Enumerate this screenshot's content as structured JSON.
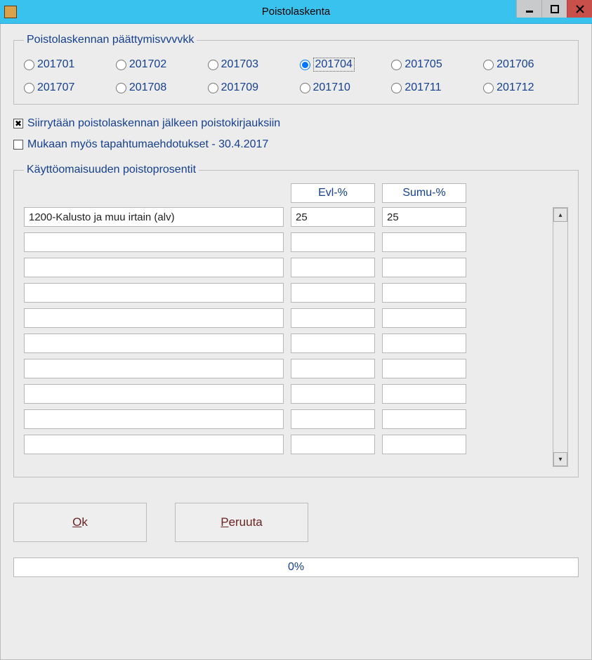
{
  "window": {
    "title": "Poistolaskenta"
  },
  "group_period": {
    "legend": "Poistolaskennan päättymisvvvvkk",
    "options": {
      "o1": "201701",
      "o2": "201702",
      "o3": "201703",
      "o4": "201704",
      "o5": "201705",
      "o6": "201706",
      "o7": "201707",
      "o8": "201708",
      "o9": "201709",
      "o10": "201710",
      "o11": "201711",
      "o12": "201712"
    },
    "selected": "o4"
  },
  "check_goto_bookings": {
    "label": "Siirrytään poistolaskennan jälkeen poistokirjauksiin",
    "checked": true
  },
  "check_include_proposals": {
    "label": "Mukaan myös tapahtumaehdotukset  - 30.4.2017",
    "checked": false
  },
  "pct": {
    "legend": "Käyttöomaisuuden poistoprosentit",
    "headers": {
      "evl": "Evl-%",
      "sumu": "Sumu-%"
    },
    "rows": [
      {
        "desc": "1200-Kalusto ja muu irtain (alv)",
        "evl": "25",
        "sumu": "25"
      },
      {
        "desc": "",
        "evl": "",
        "sumu": ""
      },
      {
        "desc": "",
        "evl": "",
        "sumu": ""
      },
      {
        "desc": "",
        "evl": "",
        "sumu": ""
      },
      {
        "desc": "",
        "evl": "",
        "sumu": ""
      },
      {
        "desc": "",
        "evl": "",
        "sumu": ""
      },
      {
        "desc": "",
        "evl": "",
        "sumu": ""
      },
      {
        "desc": "",
        "evl": "",
        "sumu": ""
      },
      {
        "desc": "",
        "evl": "",
        "sumu": ""
      },
      {
        "desc": "",
        "evl": "",
        "sumu": ""
      }
    ]
  },
  "buttons": {
    "ok": "Ok",
    "cancel": "Peruuta"
  },
  "progress": {
    "text": "0%"
  }
}
